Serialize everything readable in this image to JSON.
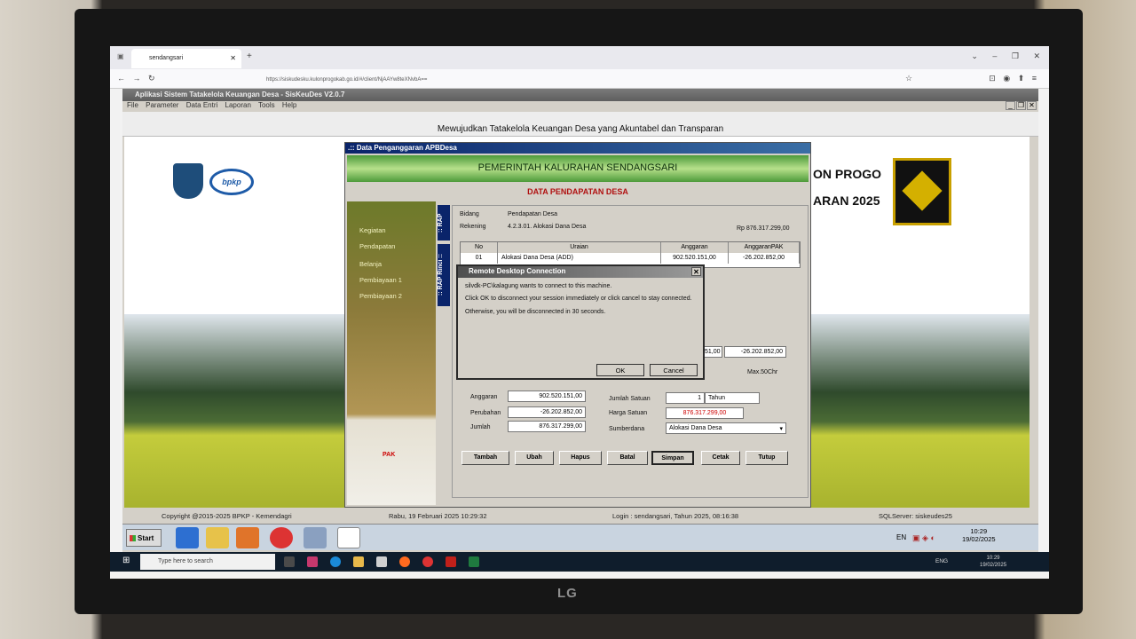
{
  "browser": {
    "tab_title": "sendangsari",
    "url": "https://siskudesku.kulonprogokab.go.id/#/client/NjAAYw8teXNvbA==",
    "nav_buttons": "← → ↻",
    "right_icons": "⊡ ◉ ⬆ ≡",
    "win_controls": "⌄ – ❐ ✕",
    "star": "☆"
  },
  "app": {
    "title": "Aplikasi Sistem Tatakelola Keuangan Desa - SisKeuDes V2.0.7",
    "menu": [
      "File",
      "Parameter",
      "Data Entri",
      "Laporan",
      "Tools",
      "Help"
    ],
    "banner": "Mewujudkan Tatakelola Keuangan Desa yang Akuntabel dan Transparan",
    "logo_text": "bpkp",
    "kabupaten_label": "ON PROGO",
    "tahun_label": "ARAN 2025"
  },
  "dialog": {
    "title": ".:: Data Penganggaran APBDesa",
    "header": "PEMERINTAH KALURAHAN SENDANGSARI",
    "subheader": "DATA PENDAPATAN DESA",
    "side_items": [
      "Kegiatan",
      "Pendapatan",
      "Belanja",
      "Pembiayaan 1",
      "Pembiayaan 2"
    ],
    "pak_label": "PAK",
    "vtab_rap": ":: RAP",
    "vtab_rinci": ":: RAP Rinci ::",
    "bidang_label": "Bidang",
    "bidang_value": "Pendapatan Desa",
    "rekening_label": "Rekening",
    "rekening_value": "4.2.3.01.  Alokasi Dana Desa",
    "rekening_total": "Rp 876.317.299,00",
    "grid": {
      "columns": [
        "No",
        "Uraian",
        "Anggaran",
        "AnggaranPAK"
      ],
      "rows": [
        {
          "no": "01",
          "uraian": "Alokasi Dana Desa (ADD)",
          "anggaran": "902.520.151,00",
          "pak": "-26.202.852,00"
        }
      ]
    },
    "sum_anggaran_partial": "51,00",
    "sum_pak": "-26.202.852,00",
    "max_chr": "Max.50Chr",
    "anggaran_label": "Anggaran",
    "anggaran_value": "902.520.151,00",
    "perubahan_label": "Perubahan",
    "perubahan_value": "-26.202.852,00",
    "jumlah_label": "Jumlah",
    "jumlah_value": "876.317.299,00",
    "jumlah_satuan_label": "Jumlah Satuan",
    "jumlah_satuan_value": "1",
    "satuan_value": "Tahun",
    "harga_satuan_label": "Harga Satuan",
    "harga_satuan_value": "876.317.299,00",
    "sumberdana_label": "Sumberdana",
    "sumberdana_value": "Alokasi Dana Desa",
    "buttons": [
      "Tambah",
      "Ubah",
      "Hapus",
      "Batal",
      "Simpan",
      "Cetak",
      "Tutup"
    ]
  },
  "rdp": {
    "title": "Remote Desktop Connection",
    "line1": "silvdk-PC\\kalagung wants to connect to this machine.",
    "line2": "Click OK to disconnect your session immediately or click cancel to stay connected.",
    "line3": "Otherwise, you will be disconnected in 30 seconds.",
    "ok": "OK",
    "cancel": "Cancel"
  },
  "statusbar": {
    "copyright": "Copyright @2015-2025 BPKP - Kemendagri",
    "datetime": "Rabu, 19 Februari 2025  10:29:32",
    "login": "Login : sendangsari,  Tahun 2025, 08:16:38",
    "server": "SQLServer: siskeudes25"
  },
  "xp_taskbar": {
    "start": "Start",
    "lang": "EN",
    "time": "10:29",
    "date": "19/02/2025"
  },
  "win_taskbar": {
    "search_placeholder": "Type here to search",
    "lang": "ENG",
    "time": "10:29",
    "date": "19/02/2025"
  },
  "monitor_brand": "LG",
  "colors": {
    "title_blue": "#0a246a",
    "header_green": "#4c9a3a",
    "accent_red": "#b01010"
  }
}
